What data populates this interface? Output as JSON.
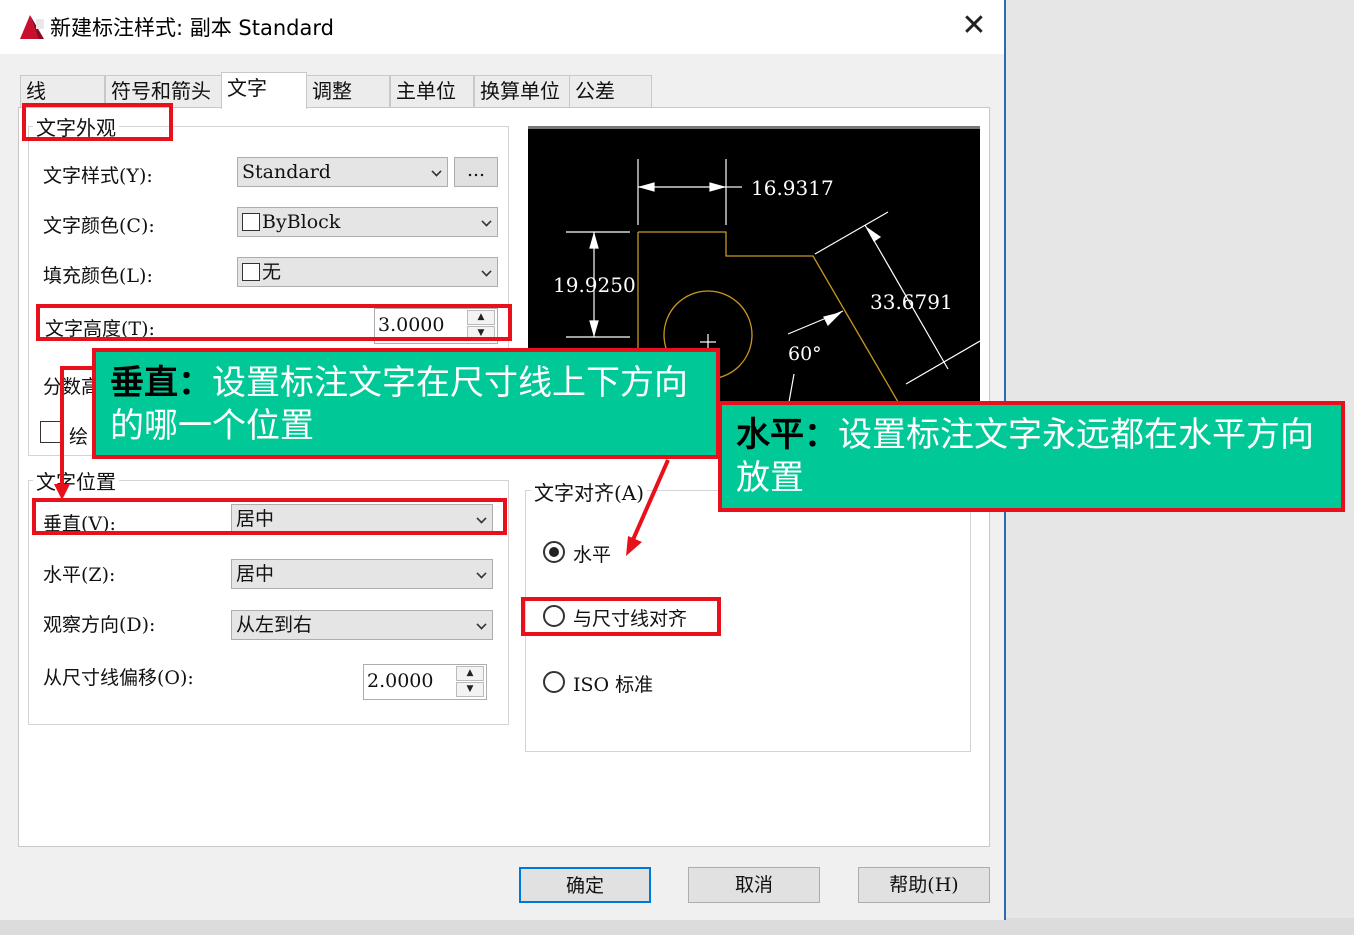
{
  "window": {
    "title": "新建标注样式: 副本 Standard",
    "close": "✕"
  },
  "tabs": [
    "线",
    "符号和箭头",
    "文字",
    "调整",
    "主单位",
    "换算单位",
    "公差"
  ],
  "appearance": {
    "title": "文字外观",
    "style_label": "文字样式(Y):",
    "style_value": "Standard",
    "style_button": "...",
    "color_label": "文字颜色(C):",
    "color_value": "ByBlock",
    "fill_label": "填充颜色(L):",
    "fill_value": "无",
    "height_label": "文字高度(T):",
    "height_value": "3.0000",
    "fraction_label": "分数高",
    "frame_label": "绘"
  },
  "position": {
    "title": "文字位置",
    "vertical_label": "垂直(V):",
    "vertical_value": "居中",
    "horizontal_label": "水平(Z):",
    "horizontal_value": "居中",
    "view_label": "观察方向(D):",
    "view_value": "从左到右",
    "offset_label": "从尺寸线偏移(O):",
    "offset_value": "2.0000"
  },
  "alignment": {
    "title": "文字对齐(A)",
    "options": [
      "水平",
      "与尺寸线对齐",
      "ISO 标准"
    ],
    "selected": 0
  },
  "preview": {
    "dim_top": "16.9317",
    "dim_left": "19.9250",
    "dim_diag": "33.6791",
    "angle": "60°"
  },
  "callouts": {
    "vertical_title": "垂直：",
    "vertical_text": "设置标注文字在尺寸线上下方向的哪一个位置",
    "horizontal_title": "水平：",
    "horizontal_text": "设置标注文字永远都在水平方向放置"
  },
  "footer": {
    "ok": "确定",
    "cancel": "取消",
    "help": "帮助(H)"
  }
}
